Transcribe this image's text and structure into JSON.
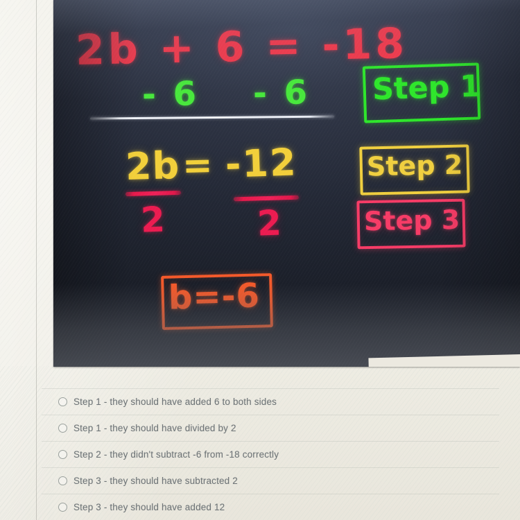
{
  "photo": {
    "board_work": {
      "line1": "2b + 6 = -18",
      "line2_left": "- 6",
      "line2_right": "- 6",
      "line3_left_numerator": "2b",
      "line3_equals": "=",
      "line3_right_numerator": "-12",
      "denominator_left": "2",
      "denominator_right": "2",
      "answer": "b=-6"
    },
    "step_labels": [
      {
        "text": "Step 1",
        "color": "#2ee62b"
      },
      {
        "text": "Step 2",
        "color": "#f0cf3f"
      },
      {
        "text": "Step 3",
        "color": "#f73b66"
      }
    ],
    "marker_colors": {
      "line1": "#f2384a",
      "line2": "#48e83c",
      "line3": "#f2cf3a",
      "fraction": "#ec1b50",
      "answer": "#f4592a",
      "divider": "#eef1f7"
    }
  },
  "options": [
    {
      "label": "Step 1 - they should have added 6 to both sides",
      "selected": false
    },
    {
      "label": "Step 1 - they should have divided by 2",
      "selected": false
    },
    {
      "label": "Step 2 - they didn't subtract -6 from -18 correctly",
      "selected": false
    },
    {
      "label": "Step 3 - they should have subtracted 2",
      "selected": false
    },
    {
      "label": "Step 3 - they should have added 12",
      "selected": false
    }
  ]
}
